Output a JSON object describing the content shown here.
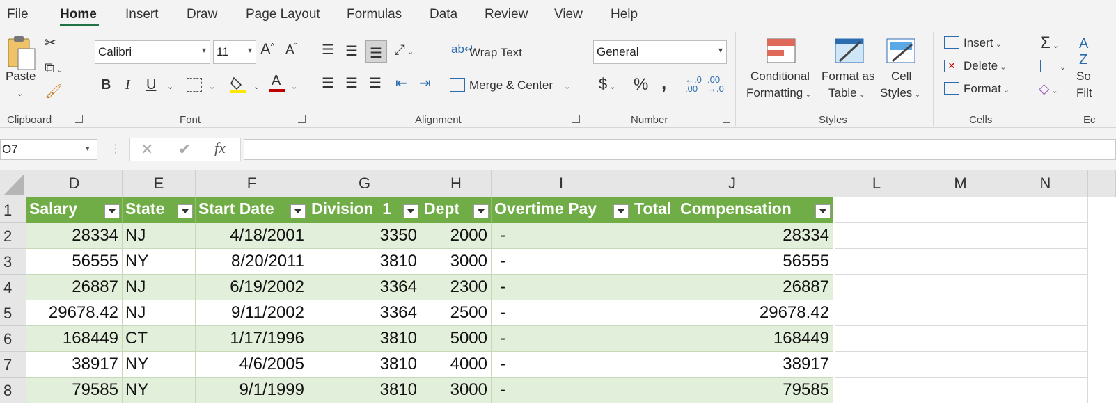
{
  "menu": {
    "tabs": [
      "File",
      "Home",
      "Insert",
      "Draw",
      "Page Layout",
      "Formulas",
      "Data",
      "Review",
      "View",
      "Help"
    ],
    "active": "Home"
  },
  "ribbon": {
    "clipboard": {
      "paste": "Paste",
      "label": "Clipboard"
    },
    "font": {
      "name": "Calibri",
      "size": "11",
      "bold": "B",
      "italic": "I",
      "underline": "U",
      "label": "Font",
      "grow": "A",
      "shrink": "A",
      "color_a": "A"
    },
    "alignment": {
      "wrap_text": "Wrap Text",
      "merge_center": "Merge & Center",
      "label": "Alignment"
    },
    "number": {
      "format": "General",
      "currency": "$",
      "percent": "%",
      "comma": ",",
      "label": "Number"
    },
    "styles": {
      "conditional": [
        "Conditional",
        "Formatting"
      ],
      "format_as_table": [
        "Format as",
        "Table"
      ],
      "cell_styles": [
        "Cell",
        "Styles"
      ],
      "label": "Styles"
    },
    "cells": {
      "insert": "Insert",
      "delete": "Delete",
      "format": "Format",
      "label": "Cells"
    },
    "editing": {
      "sort_partial": [
        "So",
        "Filt"
      ],
      "label_partial": "Ec",
      "az": "A",
      "z": "Z"
    }
  },
  "formula_bar": {
    "name_box": "O7",
    "fx": "fx",
    "value": ""
  },
  "columns": [
    "D",
    "E",
    "F",
    "G",
    "H",
    "I",
    "J",
    "L",
    "M",
    "N"
  ],
  "rows": [
    "1",
    "2",
    "3",
    "4",
    "5",
    "6",
    "7",
    "8"
  ],
  "table": {
    "headers": [
      "Salary",
      "State",
      "Start Date",
      "Division_1",
      "Dept",
      "Overtime Pay",
      "Total_Compensation"
    ],
    "data": [
      [
        "28334",
        "NJ",
        "4/18/2001",
        "3350",
        "2000",
        "-",
        "28334"
      ],
      [
        "56555",
        "NY",
        "8/20/2011",
        "3810",
        "3000",
        "-",
        "56555"
      ],
      [
        "26887",
        "NJ",
        "6/19/2002",
        "3364",
        "2300",
        "-",
        "26887"
      ],
      [
        "29678.42",
        "NJ",
        "9/11/2002",
        "3364",
        "2500",
        "-",
        "29678.42"
      ],
      [
        "168449",
        "CT",
        "1/17/1996",
        "3810",
        "5000",
        "-",
        "168449"
      ],
      [
        "38917",
        "NY",
        "4/6/2005",
        "3810",
        "4000",
        "-",
        "38917"
      ],
      [
        "79585",
        "NY",
        "9/1/1999",
        "3810",
        "3000",
        "-",
        "79585"
      ]
    ]
  },
  "colors": {
    "accent": "#217346",
    "table_header": "#70ad47",
    "band": "#e2efda"
  }
}
